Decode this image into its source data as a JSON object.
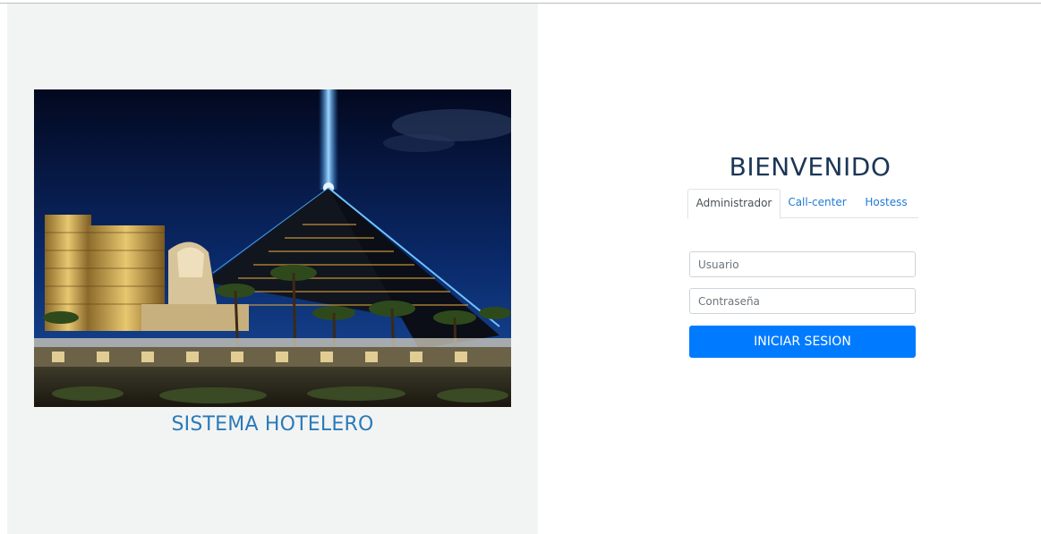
{
  "left": {
    "brand_title": "SISTEMA HOTELERO",
    "brand_color": "#2a7ab8"
  },
  "login": {
    "heading": "BIENVENIDO",
    "tabs": [
      {
        "label": "Administrador",
        "active": true
      },
      {
        "label": "Call-center",
        "active": false
      },
      {
        "label": "Hostess",
        "active": false
      }
    ],
    "username": {
      "value": "",
      "placeholder": "Usuario"
    },
    "password": {
      "value": "",
      "placeholder": "Contraseña"
    },
    "submit_label": "INICIAR SESION",
    "accent_color": "#007bff"
  }
}
